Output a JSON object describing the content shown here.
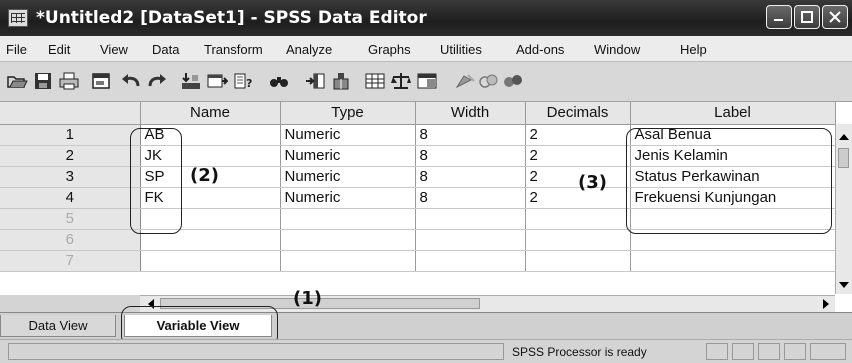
{
  "window": {
    "title": "*Untitled2 [DataSet1] - SPSS Data Editor"
  },
  "menubar": {
    "items": [
      "File",
      "Edit",
      "View",
      "Data",
      "Transform",
      "Analyze",
      "Graphs",
      "Utilities",
      "Add-ons",
      "Window",
      "Help"
    ]
  },
  "toolbar": {
    "icons": [
      "open-icon",
      "save-icon",
      "print-icon",
      "dialog-recall-icon",
      "undo-icon",
      "redo-icon",
      "goto-case-icon",
      "insert-variable-icon",
      "variables-icon",
      "find-icon",
      "insert-cases-icon",
      "split-file-icon",
      "select-cases-icon",
      "weight-cases-icon",
      "value-labels-icon",
      "use-sets-icon",
      "show-sets-icon"
    ]
  },
  "grid": {
    "headers": [
      "Name",
      "Type",
      "Width",
      "Decimals",
      "Label"
    ],
    "rows": [
      {
        "num": "1",
        "name": "AB",
        "type": "Numeric",
        "width": "8",
        "decimals": "2",
        "label": "Asal Benua"
      },
      {
        "num": "2",
        "name": "JK",
        "type": "Numeric",
        "width": "8",
        "decimals": "2",
        "label": "Jenis Kelamin"
      },
      {
        "num": "3",
        "name": "SP",
        "type": "Numeric",
        "width": "8",
        "decimals": "2",
        "label": "Status Perkawinan"
      },
      {
        "num": "4",
        "name": "FK",
        "type": "Numeric",
        "width": "8",
        "decimals": "2",
        "label": "Frekuensi Kunjungan"
      }
    ],
    "empty_rows": [
      "5",
      "6",
      "7"
    ]
  },
  "annotations": {
    "label1": "(1)",
    "label2": "(2)",
    "label3": "(3)"
  },
  "tabs": {
    "data_view": "Data View",
    "variable_view": "Variable View"
  },
  "status": {
    "text": "SPSS  Processor is ready"
  }
}
